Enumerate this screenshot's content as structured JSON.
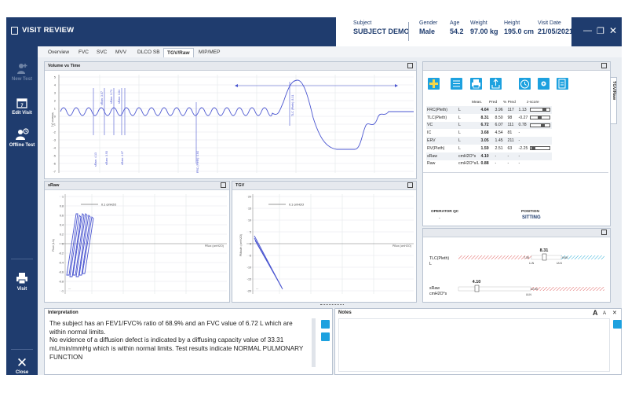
{
  "window": {
    "title": "VISIT REVIEW",
    "min_icon": "minimize-icon",
    "restore_icon": "restore-icon",
    "close_icon": "close-icon"
  },
  "patient": [
    {
      "label": "Subject",
      "value": "SUBJECT DEMO"
    },
    {
      "label": "Gender",
      "value": "Male"
    },
    {
      "label": "Age",
      "value": "54.2"
    },
    {
      "label": "Weight",
      "value": "97.00 kg"
    },
    {
      "label": "Height",
      "value": "195.0 cm"
    },
    {
      "label": "Visit Date",
      "value": "21/05/2021"
    }
  ],
  "sidebar": {
    "new_test": "New Test",
    "edit_visit": "Edit Visit",
    "offline_test": "Offline Test",
    "visit": "Visit",
    "close": "Close"
  },
  "tabs": [
    "Overview",
    "FVC",
    "SVC",
    "MVV",
    "DLCO SB",
    "TGV/Raw",
    "MIP/MEP"
  ],
  "active_tab": "TGV/Raw",
  "vol_time": {
    "title": "Volume vs Time",
    "y_ticks": [
      "5",
      "4",
      "3",
      "2",
      "1",
      "0",
      "-1",
      "-2",
      "-3",
      "-4",
      "-5",
      "-6",
      "-7"
    ],
    "y_axis_label": "Volume (L)",
    "annotations": {
      "sraw1": "sRaw: 3.07",
      "sraw2": "sRaw: 3.73",
      "sraw3": "sRaw: 3.84",
      "sraw4": "sRaw: 4.13",
      "sraw5": "sRaw: 3.93",
      "sraw6": "sRaw: 4.07",
      "frc": "FRC (Pleth): 4.64",
      "tlc": "TLC (Pleth): 8.31"
    }
  },
  "sraw": {
    "title": "sRaw",
    "scale_label": "0.1 cmH2O",
    "y_ticks": [
      "1",
      "0.8",
      "0.6",
      "0.4",
      "0.2",
      "0",
      "-0.2",
      "-0.4",
      "-0.6",
      "-0.8",
      "-1"
    ],
    "y_axis_label": "Flow (L/s)",
    "x_axis_label": "PBox (cmH2O)"
  },
  "tgv": {
    "title": "TGV",
    "scale_label": "0.1 cmH2O",
    "y_ticks": [
      "20",
      "15",
      "10",
      "5",
      "0",
      "-5",
      "-10",
      "-15",
      "-20"
    ],
    "y_axis_label": "PMouth (cmH2O)",
    "x_axis_label": "PBox (cmH2O)"
  },
  "results": {
    "vertical_tab": "TGV/Raw",
    "headers": [
      "",
      "",
      "Meas.",
      "Pred",
      "% Pred",
      "z-score"
    ],
    "rows": [
      {
        "name": "FRC(Pleth)",
        "unit": "L",
        "meas": "4.64",
        "pred": "3.96",
        "pct": "117",
        "z": "1.13",
        "z_pos": 0.72
      },
      {
        "name": "TLC(Pleth)",
        "unit": "L",
        "meas": "8.31",
        "pred": "8.50",
        "pct": "98",
        "z": "-0.27",
        "z_pos": 0.45
      },
      {
        "name": "VC",
        "unit": "L",
        "meas": "6.72",
        "pred": "6.07",
        "pct": "111",
        "z": "0.78",
        "z_pos": 0.65
      },
      {
        "name": "IC",
        "unit": "L",
        "meas": "3.68",
        "pred": "4.54",
        "pct": "81",
        "z": "-",
        "z_pos": null
      },
      {
        "name": "ERV",
        "unit": "L",
        "meas": "3.05",
        "pred": "1.45",
        "pct": "211",
        "z": "-",
        "z_pos": null
      },
      {
        "name": "RV(Pleth)",
        "unit": "L",
        "meas": "1.59",
        "pred": "2.51",
        "pct": "63",
        "z": "-2.25",
        "z_pos": 0.05
      },
      {
        "name": "sRaw",
        "unit": "cmH2O*s",
        "meas": "4.10",
        "pred": "-",
        "pct": "-",
        "z": "-",
        "z_pos": null
      },
      {
        "name": "Raw",
        "unit": "cmH2O*s/L",
        "meas": "0.88",
        "pred": "-",
        "pct": "-",
        "z": "-",
        "z_pos": null
      }
    ],
    "operator_qc_label": "OPERATOR QC",
    "operator_qc_value": "-",
    "position_label": "POSITION",
    "position_value": "SITTING",
    "toolbar_icons": [
      "add-icon",
      "list-icon",
      "print-icon",
      "export-icon",
      "calculate-icon",
      "settings-icon",
      "report-icon"
    ]
  },
  "zscore": {
    "tlc_label": "TLC(Pleth)",
    "tlc_unit": "L",
    "tlc_value": "8.31",
    "tlc_lln": "7.35",
    "tlc_uln": "9.65",
    "sraw_label": "sRaw",
    "sraw_unit": "cmH2O*s",
    "sraw_value": "4.10",
    "sraw_uln": "12.00",
    "lln_label": "LLN",
    "uln_label": "ULN"
  },
  "interpretation": {
    "title": "Interpretation",
    "text": "The subject has an FEV1/FVC% ratio of 68.9% and an FVC value of 6.72 L which are within normal limits.\nNo evidence of a diffusion defect is indicated by a diffusing capacity value of 33.31 mL/min/mmHg which is within normal limits. Test results indicate NORMAL PULMONARY FUNCTION"
  },
  "notes": {
    "title": "Notes",
    "font_large": "A",
    "font_small": "A"
  }
}
